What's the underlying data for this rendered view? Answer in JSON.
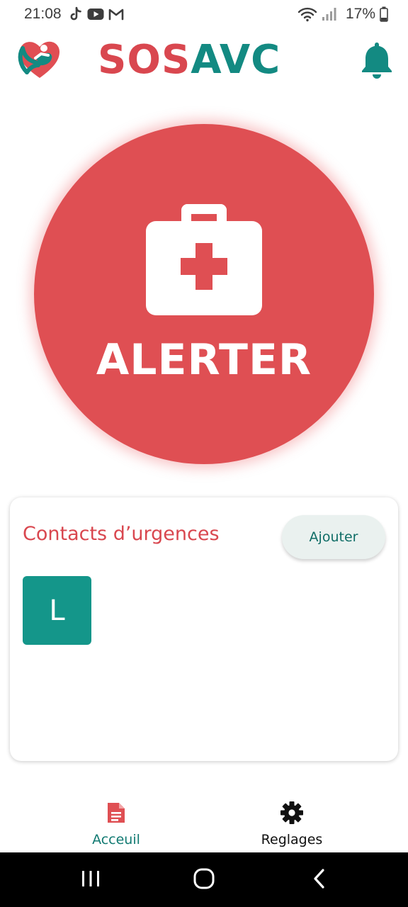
{
  "status_bar": {
    "time": "21:08",
    "battery_percent": "17%",
    "notification_icons": [
      "tiktok-icon",
      "youtube-icon",
      "gmail-icon"
    ],
    "system_icons": [
      "wifi-icon",
      "signal-icon",
      "battery-icon"
    ]
  },
  "header": {
    "brand_part1": "SOS",
    "brand_part2": "AVC",
    "logo_icon": "heart-hand-logo",
    "notification_icon": "bell-icon"
  },
  "alert": {
    "label": "ALERTER",
    "icon": "first-aid-kit-icon"
  },
  "contacts": {
    "title": "Contacts d’urgences",
    "add_label": "Ajouter",
    "items": [
      {
        "initial": "L"
      }
    ]
  },
  "bottom_nav": {
    "items": [
      {
        "label": "Acceuil",
        "icon": "document-icon",
        "active": true
      },
      {
        "label": "Reglages",
        "icon": "gear-icon",
        "active": false
      }
    ]
  },
  "colors": {
    "brand_red": "#d9474f",
    "brand_teal": "#138a82",
    "alert_red": "#df4f53",
    "avatar_teal": "#14968a"
  }
}
